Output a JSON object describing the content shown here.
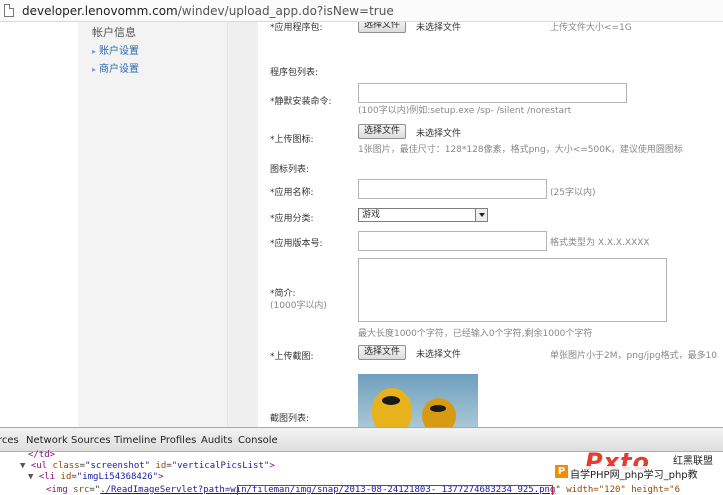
{
  "browser": {
    "url_host": "developer.lenovomm.com",
    "url_path": "/windev/upload_app.do?isNew=true"
  },
  "sidebar": {
    "title": "帐户信息",
    "items": [
      {
        "label": "账户设置"
      },
      {
        "label": "商户设置"
      }
    ]
  },
  "form": {
    "app_package_label": "*应用程序包:",
    "app_package_button": "选择文件",
    "app_package_nofile": "未选择文件",
    "app_package_hint": "上传文件大小<=1G",
    "package_list_label": "程序包列表:",
    "silent_install_label": "*静默安装命令:",
    "silent_install_hint": "(100字以内)例如:setup.exe /sp- /silent /norestart",
    "icon_label": "*上传图标:",
    "icon_button": "选择文件",
    "icon_nofile": "未选择文件",
    "icon_hint": "1张图片，最佳尺寸：128*128像素，格式png，大小<=500K，建议使用圆图标",
    "icon_list_label": "图标列表:",
    "app_name_label": "*应用名称:",
    "app_name_hint": "(25字以内)",
    "category_label": "*应用分类:",
    "category_value": "游戏",
    "version_label": "*应用版本号:",
    "version_hint": "格式类型为 X.X.X.XXXX",
    "intro_label": "*简介:",
    "intro_sublabel": "(1000字以内)",
    "intro_hint": "最大长度1000个字符，已经输入0个字符,剩余1000个字符",
    "screenshot_label": "*上传截图:",
    "screenshot_button": "选择文件",
    "screenshot_nofile": "未选择文件",
    "screenshot_hint": "单张图片小于2M，png/jpg格式，最多10",
    "screenshot_list_label": "截图列表:"
  },
  "devtools": {
    "tabs": [
      "rces",
      "Network",
      "Sources",
      "Timeline",
      "Profiles",
      "Audits",
      "Console"
    ],
    "line1": "</td>",
    "line2_tag": "ul",
    "line2_attr1": "class",
    "line2_val1": "\"screenshot\"",
    "line2_attr2": "id",
    "line2_val2": "\"verticalPicsList\"",
    "line3_tag": "li",
    "line3_attr": "id",
    "line3_val": "\"imgLi54368426\"",
    "line4_tag": "img",
    "line4_attr": "src",
    "line4_link": "./ReadImageServlet?path=win/fileman/img/snap/2013-08-24121803- 1377274683234_925.png",
    "line4_rest": "width=\"120\" height=\"6"
  },
  "watermark": {
    "logo_letter": "P",
    "text": "自学PHP网_php学习_php教",
    "big": "Pxto",
    "cn": "红黑联盟"
  }
}
